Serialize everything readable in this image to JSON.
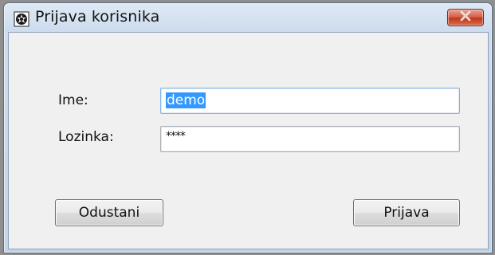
{
  "window": {
    "title": "Prijava korisnika",
    "close_icon": "close-icon",
    "app_icon": "app-icon"
  },
  "form": {
    "username_label": "Ime:",
    "username_value": "demo",
    "password_label": "Lozinka:",
    "password_value": "****"
  },
  "buttons": {
    "cancel_label": "Odustani",
    "login_label": "Prijava"
  },
  "colors": {
    "selection": "#3399ff",
    "close_button": "#c1371c"
  }
}
